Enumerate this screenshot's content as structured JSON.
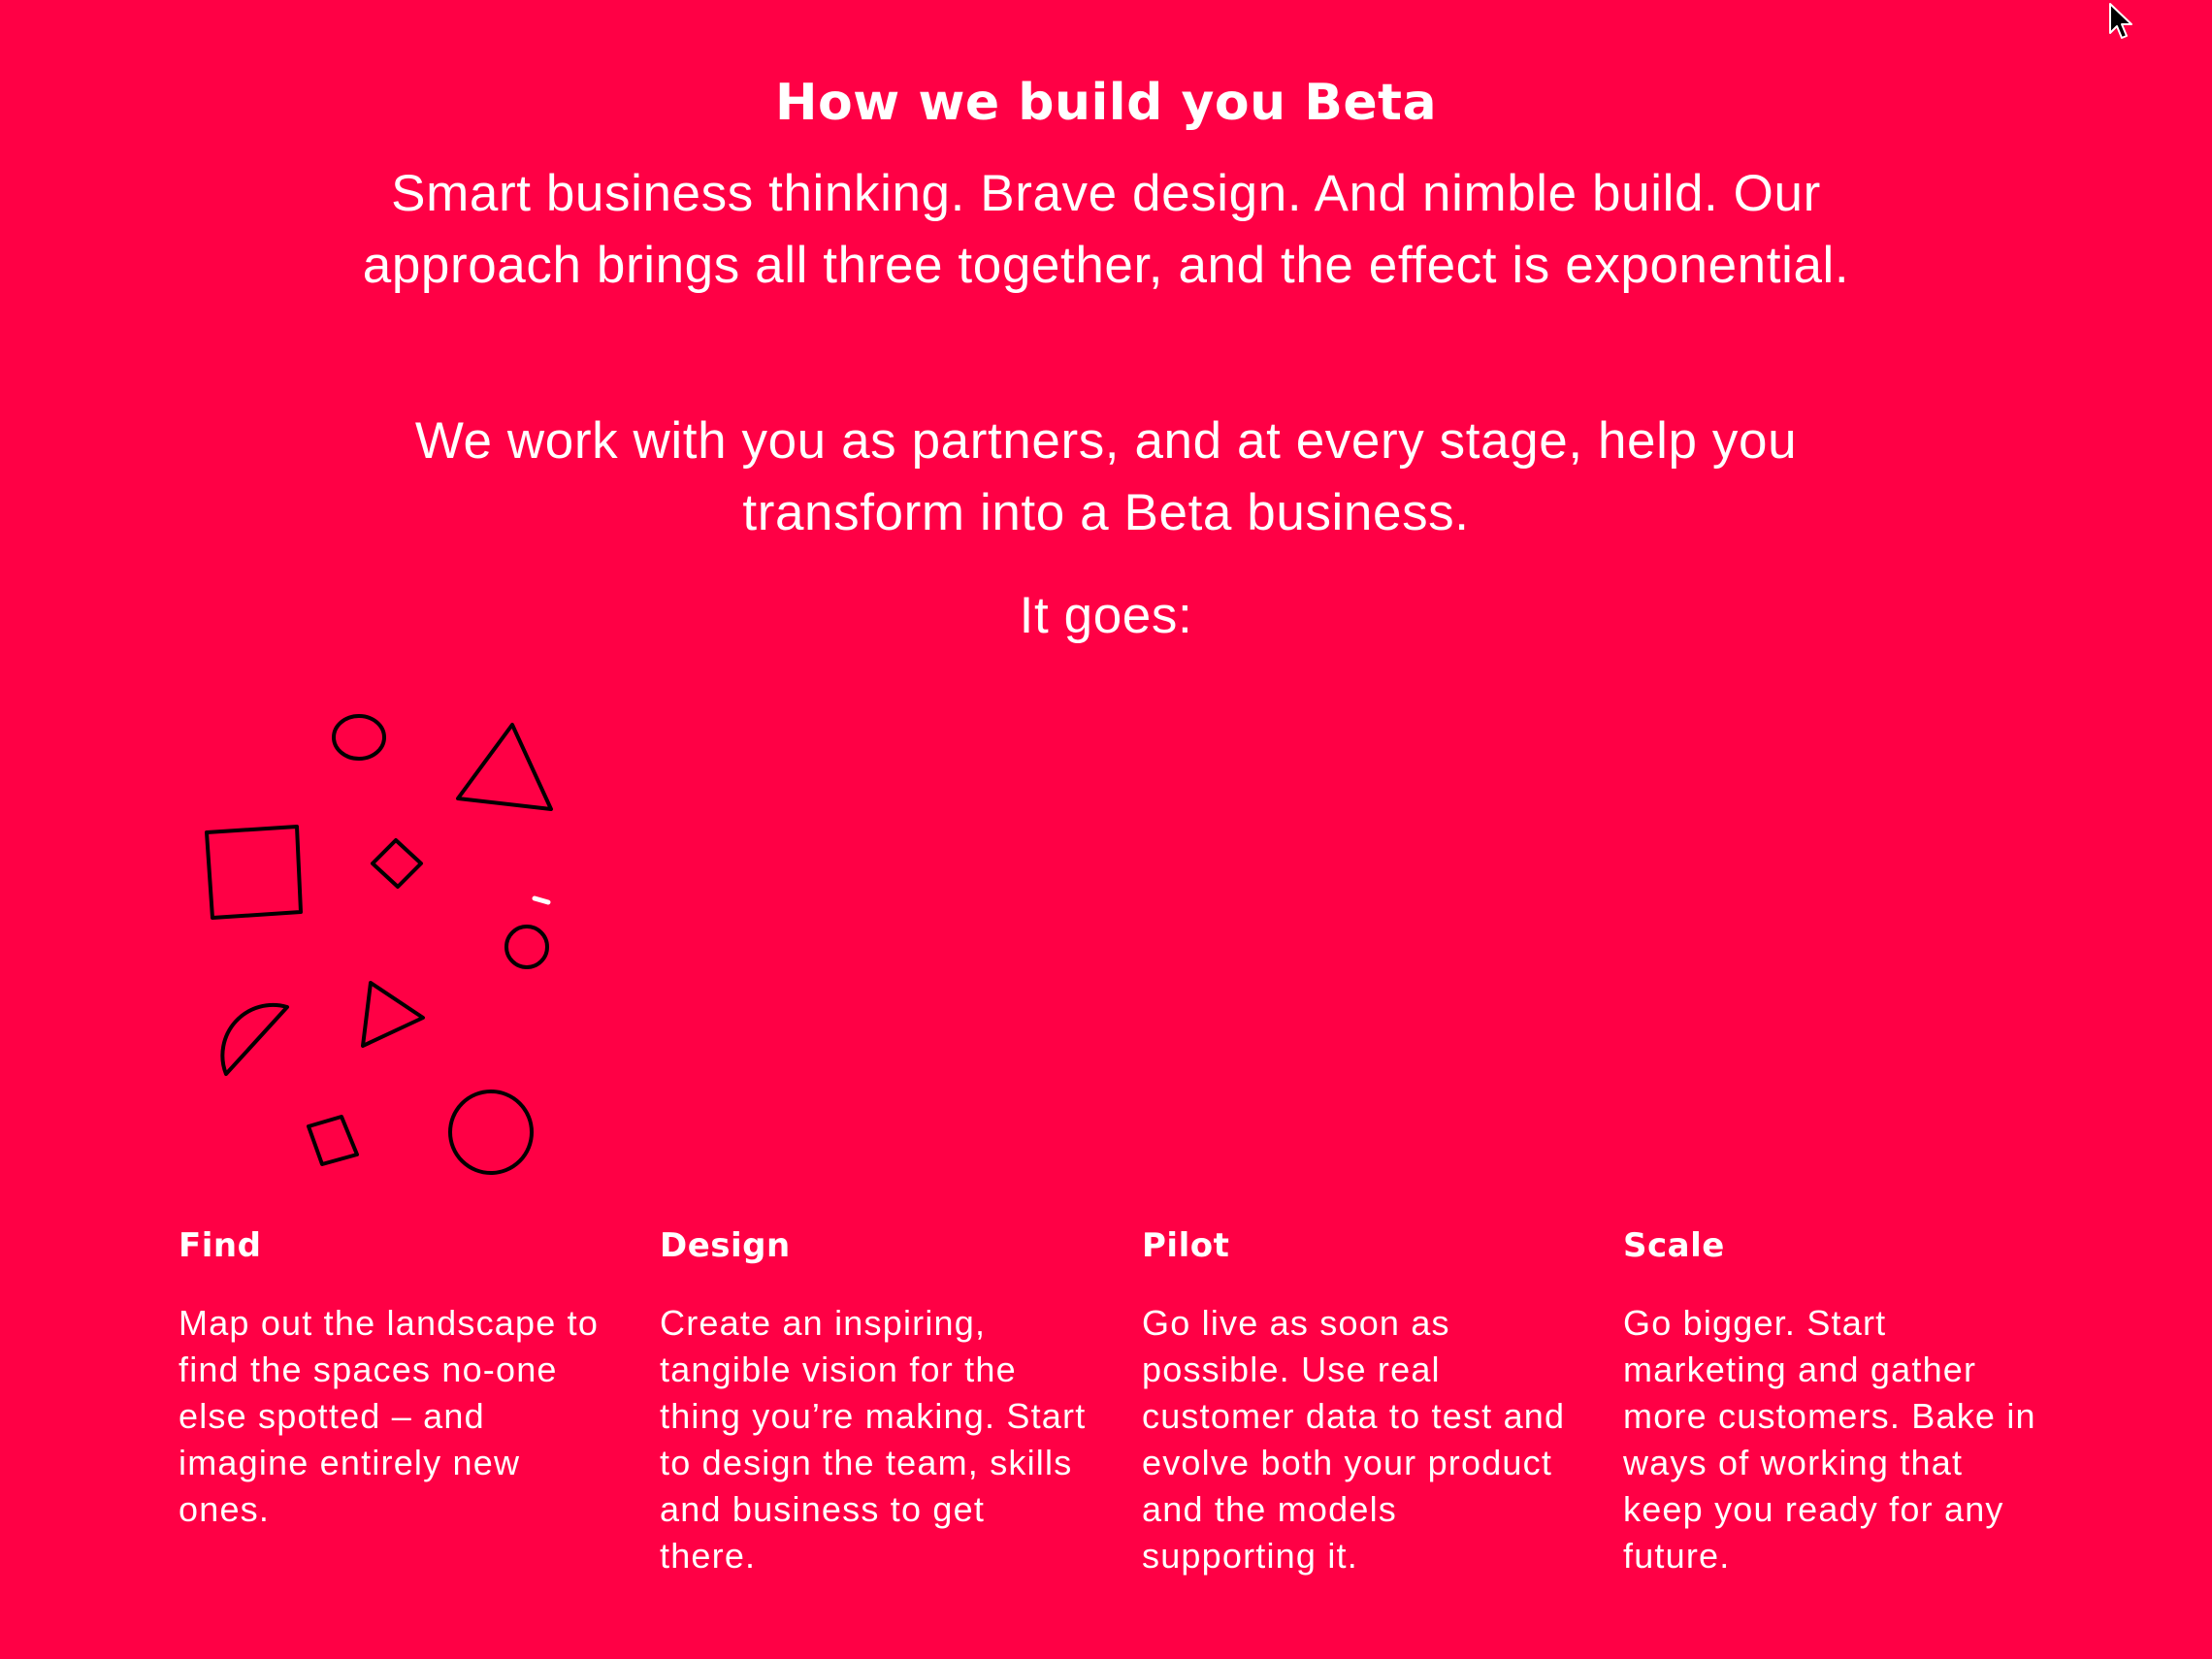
{
  "section": {
    "title": "How we build you Beta",
    "intro_1": "Smart business thinking. Brave design. And nimble build. Our approach brings all three together, and the effect is exponential.",
    "intro_2": "We work with you as partners, and at every stage, help you transform into a Beta business.",
    "intro_3": "It goes:"
  },
  "steps": [
    {
      "title": "Find",
      "text": "Map out the landscape to find the spaces no-one else spotted – and imagine entirely new ones."
    },
    {
      "title": "Design",
      "text": "Create an inspiring, tangible vision for the thing you’re making. Start to design the team, skills and business to get there."
    },
    {
      "title": "Pilot",
      "text": "Go live as soon as possible. Use real customer data to test and evolve both your product and the models supporting it."
    },
    {
      "title": "Scale",
      "text": "Go bigger. Start marketing and gather more customers. Bake in ways of working that keep you ready for any future."
    }
  ],
  "colors": {
    "background": "#ff0045",
    "text": "#ffffff",
    "shape_stroke": "#000000"
  },
  "icons": [
    "shapes-illustration",
    "mouse-cursor-icon"
  ]
}
